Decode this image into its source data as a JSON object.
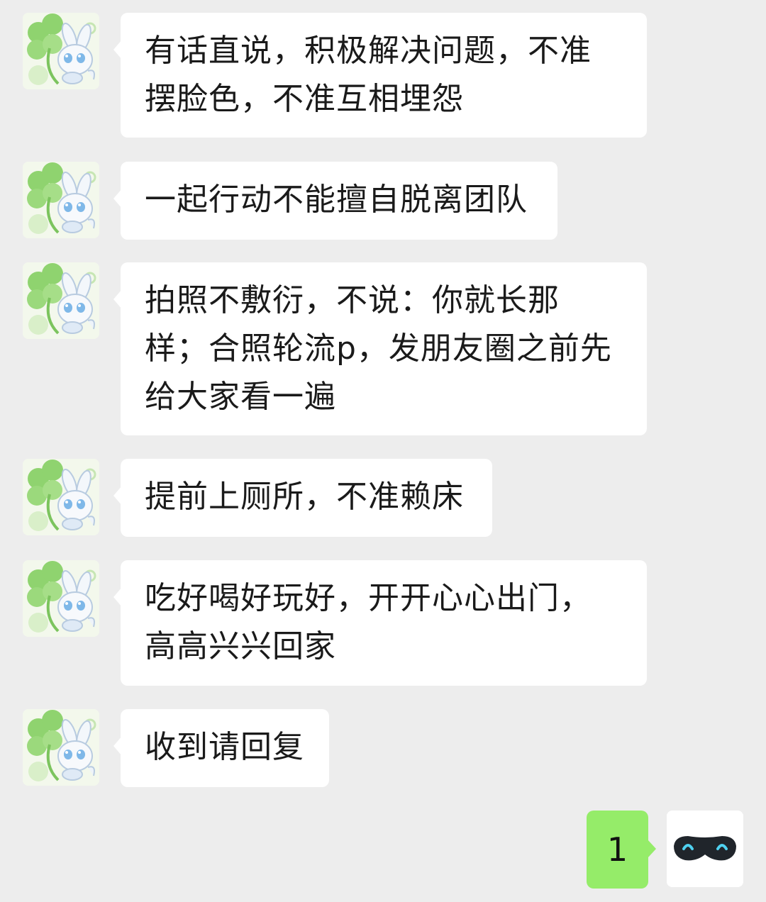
{
  "messages": [
    {
      "sender": "other",
      "text": "有话直说，积极解决问题，不准摆脸色，不准互相埋怨"
    },
    {
      "sender": "other",
      "text": "一起行动不能擅自脱离团队"
    },
    {
      "sender": "other",
      "text": "拍照不敷衍，不说：你就长那样；合照轮流p，发朋友圈之前先给大家看一遍"
    },
    {
      "sender": "other",
      "text": "提前上厕所，不准赖床"
    },
    {
      "sender": "other",
      "text": "吃好喝好玩好，开开心心出门，高高兴兴回家"
    },
    {
      "sender": "other",
      "text": "收到请回复"
    }
  ],
  "reply": {
    "sender": "self",
    "text": "1"
  },
  "avatars": {
    "other": "clover-bunny-avatar",
    "self": "sleep-mask-avatar"
  },
  "colors": {
    "background": "#ededed",
    "incoming_bubble": "#ffffff",
    "outgoing_bubble": "#95ec69"
  }
}
